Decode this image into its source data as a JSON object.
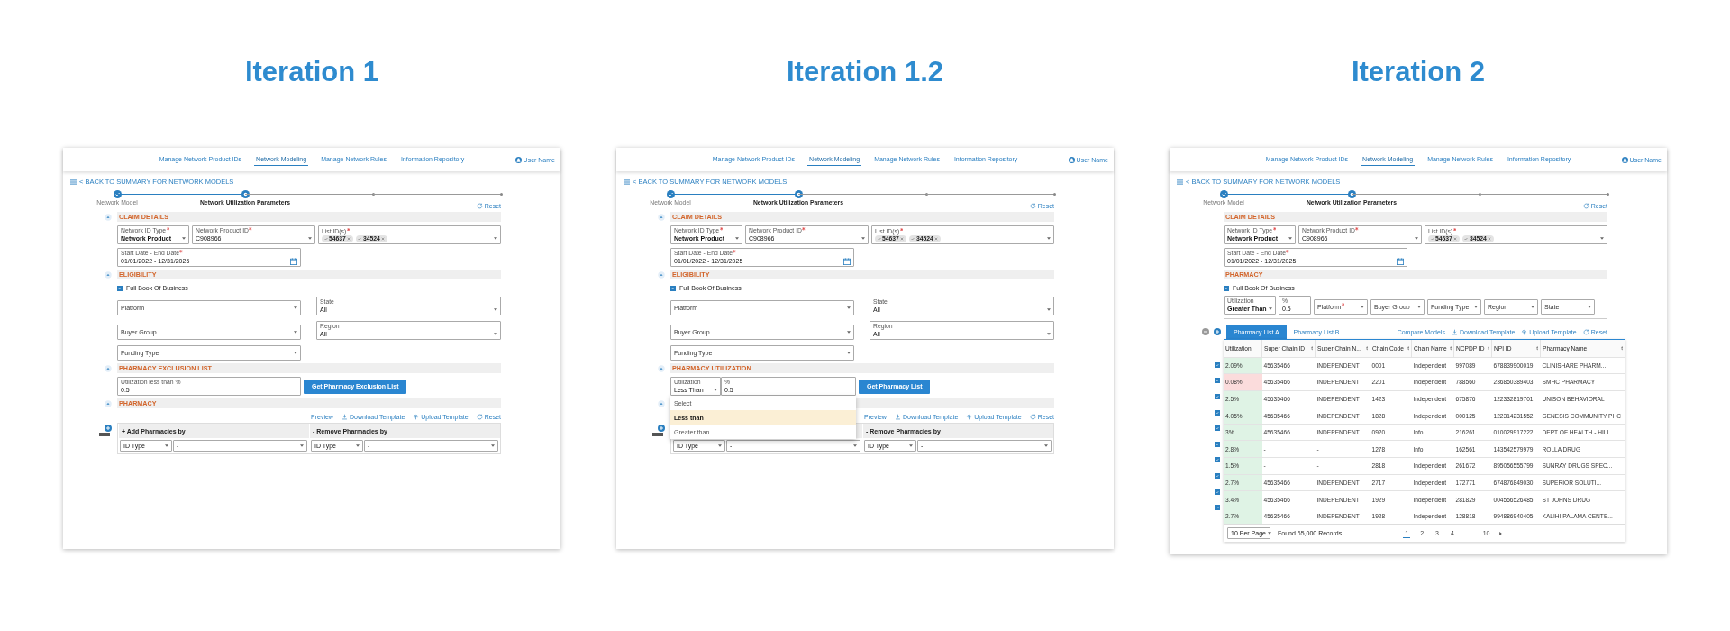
{
  "iterations": [
    {
      "title": "Iteration 1",
      "nav": [
        {
          "label": "Manage Network Product IDs",
          "selected": false
        },
        {
          "label": "Network Modeling",
          "selected": true
        },
        {
          "label": "Manage Network Rules",
          "selected": false
        },
        {
          "label": "Information Repository",
          "selected": false
        }
      ],
      "user": "User Name",
      "back_link": "< BACK TO SUMMARY FOR NETWORK MODELS",
      "steps": [
        {
          "label": "Network Model",
          "completed": true,
          "selected": false
        },
        {
          "label": "Network Utilization Parameters",
          "completed": false,
          "selected": true
        },
        {
          "completed": false,
          "selected": false
        },
        {
          "completed": false,
          "selected": false
        }
      ],
      "reset": "Reset",
      "sections": [
        {
          "kind": "claim",
          "title": "CLAIM DETAILS",
          "collapsible": true,
          "id_type": {
            "label": "Network ID Type",
            "required": true,
            "value": "Network Product"
          },
          "product_id": {
            "label": "Network Product ID",
            "required": true,
            "value": "C908966"
          },
          "list_ids": {
            "label": "List ID(s)",
            "required": true,
            "chips": [
              "54637",
              "34524"
            ]
          },
          "dates": {
            "label": "Start Date - End Date",
            "required": true,
            "value": "01/01/2022 - 12/31/2025"
          }
        },
        {
          "kind": "eligibility",
          "title": "ELIGIBILITY",
          "collapsible": true,
          "full_book": {
            "label": "Full Book Of Business",
            "checked": true
          },
          "filters": [
            {
              "placeholder": "Platform"
            },
            {
              "label": "State",
              "value": "All"
            },
            {
              "placeholder": "Buyer Group"
            },
            {
              "label": "Region",
              "value": "All"
            },
            {
              "placeholder": "Funding Type"
            }
          ]
        },
        {
          "kind": "exclusion",
          "title": "PHARMACY EXCLUSION LIST",
          "collapsible": true,
          "input": {
            "label": "Utilization less than %",
            "value": "0.5"
          },
          "button": "Get Pharmacy Exclusion List"
        },
        {
          "kind": "pharmacy",
          "title": "PHARMACY",
          "collapsible": true,
          "actions": [
            "Preview",
            "Download Template",
            "Upload Template",
            "Reset"
          ],
          "add_header": "+ Add Pharmacies by",
          "remove_header": "- Remove Pharmacies by",
          "add_row": {
            "type": "ID Type",
            "value": "-"
          },
          "remove_row": {
            "type": "ID Type",
            "value": "-"
          }
        }
      ]
    },
    {
      "title": "Iteration 1.2",
      "nav": [
        {
          "label": "Manage Network Product IDs",
          "selected": false
        },
        {
          "label": "Network Modeling",
          "selected": true
        },
        {
          "label": "Manage Network Rules",
          "selected": false
        },
        {
          "label": "Information Repository",
          "selected": false
        }
      ],
      "user": "User Name",
      "back_link": "< BACK TO SUMMARY FOR NETWORK MODELS",
      "steps": [
        {
          "label": "Network Model",
          "completed": true,
          "selected": false
        },
        {
          "label": "Network Utilization Parameters",
          "completed": false,
          "selected": true
        },
        {
          "completed": false,
          "selected": false
        },
        {
          "completed": false,
          "selected": false
        }
      ],
      "reset": "Reset",
      "sections": [
        {
          "kind": "claim",
          "title": "CLAIM DETAILS",
          "collapsible": true,
          "id_type": {
            "label": "Network ID Type",
            "required": true,
            "value": "Network Product"
          },
          "product_id": {
            "label": "Network Product ID",
            "required": true,
            "value": "C908966"
          },
          "list_ids": {
            "label": "List ID(s)",
            "required": true,
            "chips": [
              "54637",
              "34524"
            ]
          },
          "dates": {
            "label": "Start Date - End Date",
            "required": true,
            "value": "01/01/2022 - 12/31/2025"
          }
        },
        {
          "kind": "eligibility",
          "title": "ELIGIBILITY",
          "collapsible": true,
          "full_book": {
            "label": "Full Book Of Business",
            "checked": true
          },
          "filters": [
            {
              "placeholder": "Platform"
            },
            {
              "label": "State",
              "value": "All"
            },
            {
              "placeholder": "Buyer Group"
            },
            {
              "label": "Region",
              "value": "All"
            },
            {
              "placeholder": "Funding Type"
            }
          ]
        },
        {
          "kind": "utilization",
          "title": "PHARMACY UTILIZATION",
          "collapsible": true,
          "operator": {
            "label": "Utilization",
            "value": "Less Than"
          },
          "percent": {
            "label": "%",
            "value": "0.5"
          },
          "button": "Get Pharmacy List",
          "dropdown": [
            {
              "label": "Select",
              "selected": false
            },
            {
              "label": "Less than",
              "selected": true
            },
            {
              "label": "Greater than",
              "selected": false
            }
          ]
        },
        {
          "kind": "pharmacy",
          "collapsible": true,
          "actions": [
            "Preview",
            "Download Template",
            "Upload Template",
            "Reset"
          ],
          "remove_header": "- Remove Pharmacies by",
          "add_row": {
            "type": "ID Type",
            "value": "-"
          },
          "remove_row": {
            "type": "ID Type",
            "value": "-"
          }
        }
      ]
    },
    {
      "title": "Iteration 2",
      "nav": [
        {
          "label": "Manage Network Product IDs",
          "selected": false
        },
        {
          "label": "Network Modeling",
          "selected": true
        },
        {
          "label": "Manage Network Rules",
          "selected": false
        },
        {
          "label": "Information Repository",
          "selected": false
        }
      ],
      "user": "User Name",
      "back_link": "< BACK TO SUMMARY FOR NETWORK MODELS",
      "steps": [
        {
          "label": "Network Model",
          "completed": true,
          "selected": false
        },
        {
          "label": "Network Utilization Parameters",
          "completed": false,
          "selected": true
        },
        {
          "completed": false,
          "selected": false
        },
        {
          "completed": false,
          "selected": false
        }
      ],
      "reset": "Reset",
      "sections": [
        {
          "kind": "claim",
          "title": "CLAIM DETAILS",
          "collapsible": false,
          "id_type": {
            "label": "Network ID Type",
            "required": true,
            "value": "Network Product"
          },
          "product_id": {
            "label": "Network Product ID",
            "required": true,
            "value": "C908966"
          },
          "list_ids": {
            "label": "List ID(s)",
            "required": true,
            "chips": [
              "54637",
              "34524"
            ]
          },
          "dates": {
            "label": "Start Date - End Date",
            "required": true,
            "value": "01/01/2022 - 12/31/2025"
          }
        },
        {
          "kind": "pharmacy_list",
          "title": "PHARMACY",
          "collapsible": false,
          "full_book": {
            "label": "Full Book Of Business",
            "checked": true
          },
          "filters": [
            {
              "kind": "select",
              "label": "Utilization",
              "value": "Greater Than"
            },
            {
              "kind": "input",
              "label": "%",
              "value": "0.5"
            },
            {
              "kind": "select",
              "placeholder": "Platform",
              "required": true
            },
            {
              "kind": "select",
              "placeholder": "Buyer Group"
            },
            {
              "kind": "select",
              "placeholder": "Funding Type"
            },
            {
              "kind": "select",
              "placeholder": "Region"
            },
            {
              "kind": "select",
              "placeholder": "State"
            }
          ],
          "tabs": [
            {
              "label": "Pharmacy List A",
              "selected": true
            },
            {
              "label": "Pharmacy List B",
              "selected": false
            }
          ],
          "actions": [
            "Compare Models",
            "Download Template",
            "Upload Template",
            "Reset"
          ],
          "table": {
            "columns": [
              {
                "label": "Utilization",
                "sortable": false
              },
              {
                "label": "Super Chain ID",
                "sortable": true
              },
              {
                "label": "Super Chain N...",
                "sortable": true
              },
              {
                "label": "Chain Code",
                "sortable": true
              },
              {
                "label": "Chain Name",
                "sortable": true
              },
              {
                "label": "NCPDP ID",
                "sortable": true
              },
              {
                "label": "NPI ID",
                "sortable": true
              },
              {
                "label": "Pharmacy Name",
                "sortable": true
              }
            ],
            "rows": [
              {
                "checked": true,
                "color": "#dff3e5",
                "cells": [
                  "2.09%",
                  "45635466",
                  "INDEPENDENT",
                  "0001",
                  "Independent",
                  "997089",
                  "678839900019",
                  "CLINISHARE PHARM..."
                ]
              },
              {
                "checked": true,
                "color": "#fbdcdc",
                "cells": [
                  "0.08%",
                  "45635466",
                  "INDEPENDENT",
                  "2201",
                  "Independent",
                  "788560",
                  "236850389403",
                  "SMHC PHARMACY"
                ]
              },
              {
                "checked": true,
                "color": "#dff3e5",
                "cells": [
                  "2.5%",
                  "45635466",
                  "INDEPENDENT",
                  "1423",
                  "Independent",
                  "675876",
                  "122332819701",
                  "UNISON BEHAVIORAL"
                ]
              },
              {
                "checked": true,
                "color": "#dff3e5",
                "cells": [
                  "4.05%",
                  "45635466",
                  "INDEPENDENT",
                  "1828",
                  "Independent",
                  "000125",
                  "122314231552",
                  "GENESIS COMMUNITY PHC"
                ]
              },
              {
                "checked": true,
                "color": "#dff3e5",
                "cells": [
                  "3%",
                  "45635466",
                  "INDEPENDENT",
                  "0920",
                  "Info",
                  "216261",
                  "010029917222",
                  "DEPT OF HEALTH - HILL..."
                ]
              },
              {
                "checked": true,
                "color": "#dff3e5",
                "cells": [
                  "2.8%",
                  "-",
                  "-",
                  "1278",
                  "Info",
                  "162561",
                  "143542579979",
                  "ROLLA DRUG"
                ]
              },
              {
                "checked": true,
                "color": "#dff3e5",
                "cells": [
                  "1.5%",
                  "-",
                  "-",
                  "2818",
                  "Independent",
                  "261672",
                  "895056555799",
                  "SUNRAY DRUGS SPEC..."
                ]
              },
              {
                "checked": true,
                "color": "#dff3e5",
                "cells": [
                  "2.7%",
                  "45635466",
                  "INDEPENDENT",
                  "2717",
                  "Independent",
                  "172771",
                  "674876849030",
                  "SUPERIOR SOLUTI..."
                ]
              },
              {
                "checked": true,
                "color": "#dff3e5",
                "cells": [
                  "3.4%",
                  "45635466",
                  "INDEPENDENT",
                  "1929",
                  "Independent",
                  "281829",
                  "004556526485",
                  "ST JOHNS DRUG"
                ]
              },
              {
                "checked": true,
                "color": "#dff3e5",
                "cells": [
                  "2.7%",
                  "45635466",
                  "INDEPENDENT",
                  "1928",
                  "Independent",
                  "128818",
                  "994886940405",
                  "KALIHI PALAMA CENTE..."
                ]
              }
            ]
          },
          "pagination": {
            "page_size": "10 Per Page",
            "records": "Found 65,000 Records",
            "pages": [
              {
                "label": "1",
                "selected": true
              },
              {
                "label": "2",
                "selected": false
              },
              {
                "label": "3",
                "selected": false
              },
              {
                "label": "4",
                "selected": false
              },
              {
                "label": "...",
                "selected": false
              },
              {
                "label": "10",
                "selected": false
              }
            ]
          }
        }
      ]
    }
  ]
}
